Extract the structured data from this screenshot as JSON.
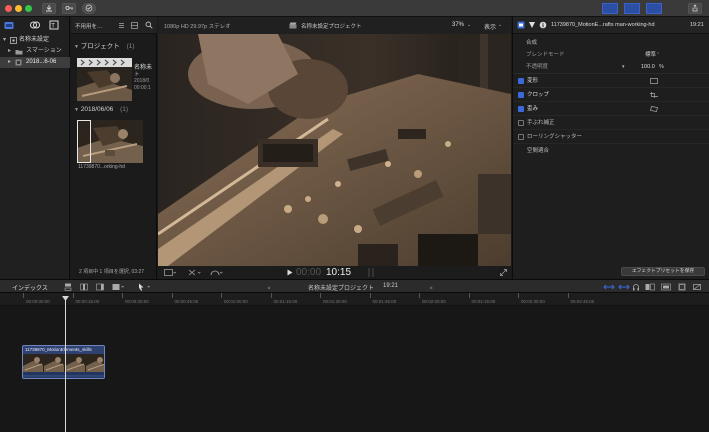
{
  "titlebar": {
    "lights": [
      "#fc5f57",
      "#fdbc2e",
      "#33c748"
    ],
    "import_icon": "download-icon",
    "keys_icon": "key-icon",
    "check_icon": "checkmark-icon"
  },
  "library": {
    "root": "名称未設定",
    "items": [
      {
        "label": "スマーション",
        "selected": false
      },
      {
        "label": "2018...6-06",
        "selected": true
      }
    ]
  },
  "browser": {
    "filter_label": "不用用を…",
    "project_header": "プロジェクト",
    "project_count": "(1)",
    "project_item": {
      "name": "名称未",
      "sub1": "ト",
      "sub2": "2018/0",
      "sub3": "00:00:1"
    },
    "date_header": "2018/06/06",
    "date_count": "(1)",
    "clip_caption": "11739870...orking-hd",
    "status": "2 項目中 1 項目を選択, 03:27"
  },
  "viewer": {
    "format": "1080p HD 29.97p ステレオ",
    "project_title": "名称未設定プロジェクト",
    "zoom": "37%",
    "display_label": "表示",
    "timecode_dim": "00:00",
    "timecode": "10:15"
  },
  "inspector": {
    "clip_title": "11739870_MotionE...rafts man-working-hd",
    "clip_duration": "19:21",
    "section": "合成",
    "blend_mode_label": "ブレンドモード",
    "blend_mode_value": "標準",
    "opacity_label": "不透明度",
    "opacity_value": "100.0",
    "opacity_unit": "%",
    "rows": [
      {
        "label": "変形",
        "checked": true
      },
      {
        "label": "クロップ",
        "checked": true
      },
      {
        "label": "歪み",
        "checked": true
      },
      {
        "label": "手ぶれ補正",
        "checked": false
      },
      {
        "label": "ローリングシャッター",
        "checked": false
      },
      {
        "label": "空間適合",
        "checked": null
      }
    ],
    "save_preset": "エフェクトプリセットを保存"
  },
  "timeline": {
    "index_label": "インデックス",
    "project_title": "名称未設定プロジェクト",
    "duration": "19:21",
    "ruler_ticks": [
      "00:00:00:00",
      "00:00:15:00",
      "00:00:30:00",
      "00:00:45:00",
      "00:01:00:00",
      "00:01:15:00",
      "00:01:30:00",
      "00:01:45:00",
      "00:02:00:00",
      "00:02:15:00",
      "00:02:30:00",
      "00:02:45:00"
    ],
    "clip_label": "11739870_MotionElements_skills"
  }
}
